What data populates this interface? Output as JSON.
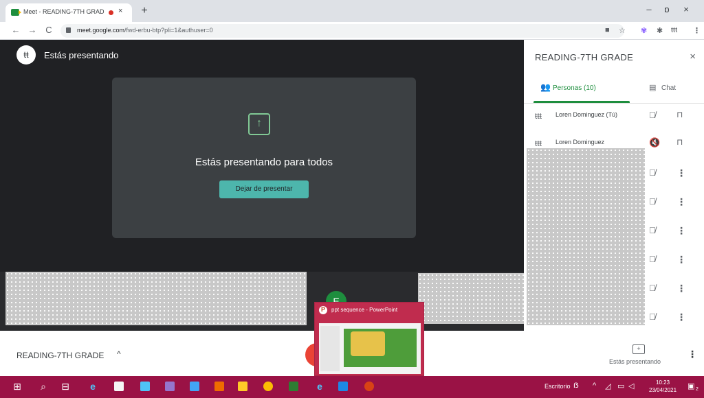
{
  "browser": {
    "tab_title": "Meet - READING-7TH GRAD",
    "tab_close": "×",
    "new_tab": "+",
    "url_domain": "meet.google.com",
    "url_path": "/fwd-erbu-btp?pli=1&authuser=0",
    "back": "←",
    "forward": "→",
    "reload": "C",
    "minimize": "–",
    "restore": "ɒ",
    "close": "×"
  },
  "stage": {
    "presenting_label": "Estás presentando",
    "share_message": "Estás presentando para todos",
    "stop_button": "Dejar de presentar",
    "tile_initial": "E"
  },
  "panel": {
    "title": "READING-7TH GRADE",
    "close": "×",
    "people_tab": "Personas (10)",
    "chat_tab": "Chat",
    "participants": [
      {
        "name": "Loren Dominguez (Tú)",
        "action": "pin"
      },
      {
        "name": "Loren Dominguez",
        "action": "pin"
      },
      {
        "name": "",
        "action": "more"
      },
      {
        "name": "",
        "action": "more"
      },
      {
        "name": "",
        "action": "more"
      },
      {
        "name": "",
        "action": "more"
      },
      {
        "name": "",
        "action": "more"
      },
      {
        "name": "",
        "action": "more"
      }
    ]
  },
  "bottombar": {
    "meeting_title": "READING-7TH GRADE",
    "title_chevron": "^",
    "present_label": "Estás presentando",
    "more": "⋮"
  },
  "ppt_popup": {
    "title": "ppt sequence - PowerPoint"
  },
  "taskbar": {
    "search_label": "Escritorio",
    "time": "10:23",
    "date": "23/04/2021",
    "notifications": "2"
  },
  "colors": {
    "accent_green": "#1e8e3e",
    "stop_button": "#4db6ac",
    "taskbar": "#9a1245",
    "end_call": "#ea4335"
  }
}
